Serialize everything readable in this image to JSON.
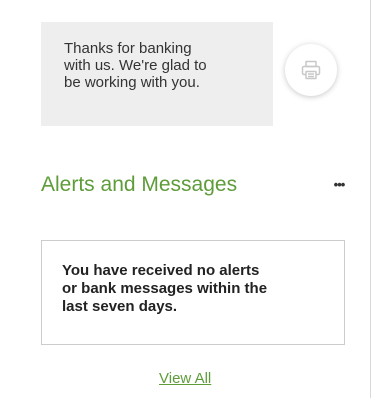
{
  "welcome": {
    "lines": [
      "Thanks for banking",
      "with us. We're glad to",
      "be working with you."
    ]
  },
  "print_button": {
    "icon": "printer-icon"
  },
  "alerts": {
    "title": "Alerts and Messages",
    "more_label": "•••",
    "more_icon": "more-horizontal-icon",
    "message_lines": [
      "You have received no alerts",
      "or bank messages within the",
      "last seven days."
    ],
    "view_all_label": "View All"
  },
  "colors": {
    "accent": "#5e9c3a",
    "welcome_bg": "#eeeeee",
    "text": "#333333"
  }
}
